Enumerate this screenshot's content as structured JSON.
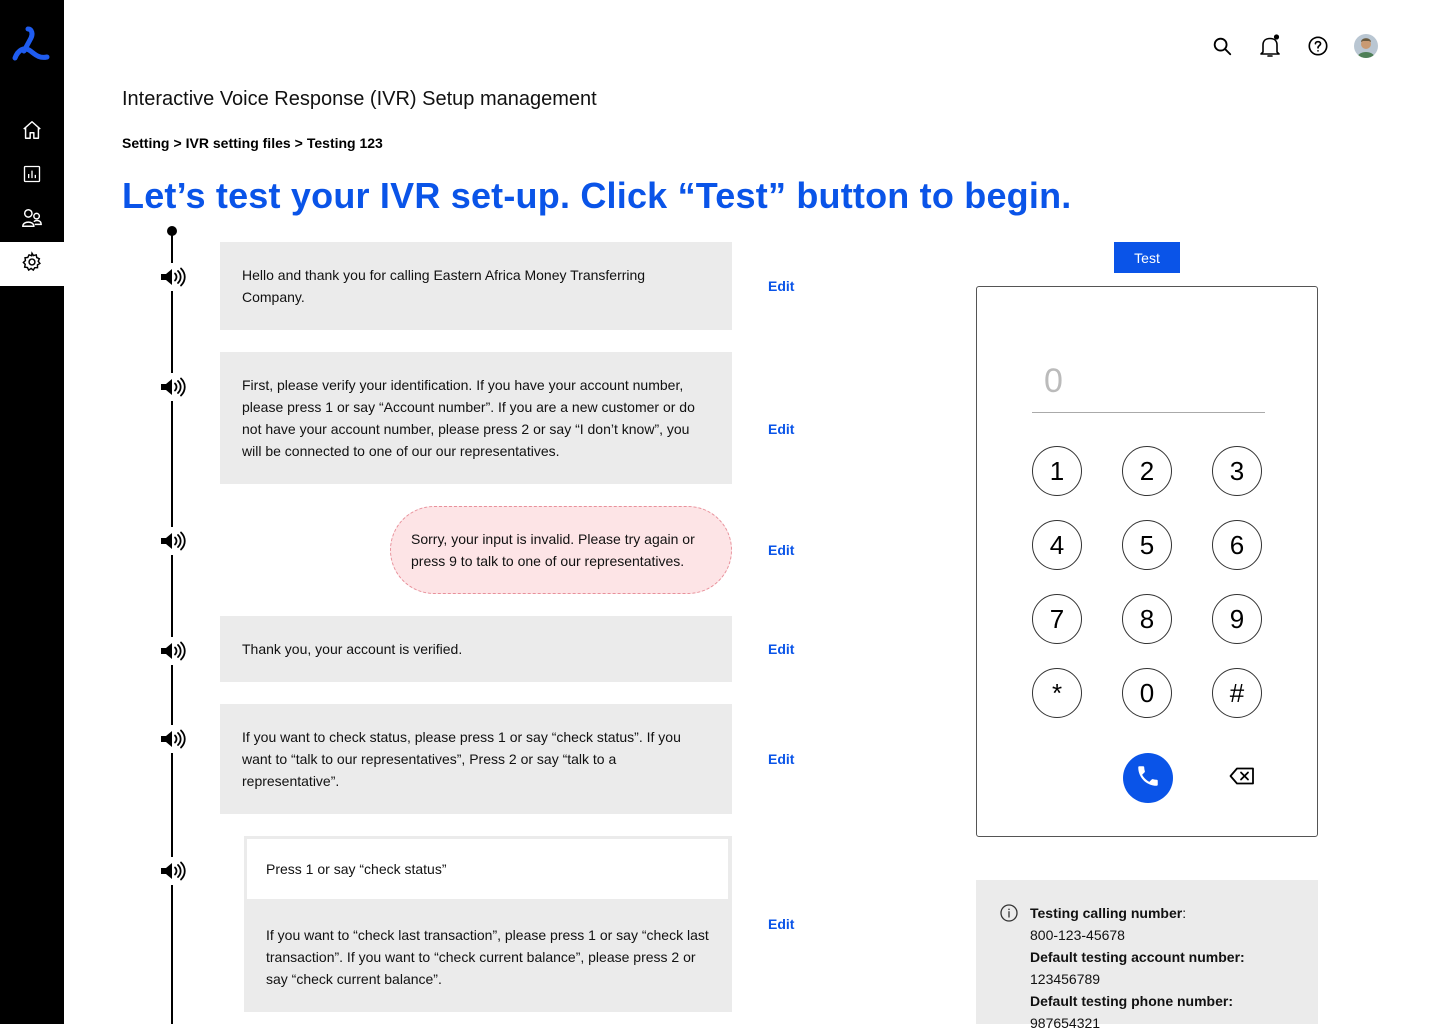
{
  "page": {
    "title": "Interactive Voice Response (IVR) Setup management",
    "headline": "Let’s test your IVR set-up. Click “Test” button to begin."
  },
  "breadcrumb": {
    "items": [
      "Setting",
      "IVR setting files",
      "Testing 123"
    ],
    "separator": ">"
  },
  "messages": [
    "Hello and thank you for calling Eastern Africa Money Transferring Company.",
    "First, please verify your identification. If you have your account number, please press 1 or say “Account number”. If you are a new customer or do not have your account number, please press 2 or say “I don’t know”, you will be connected to one of our our representatives.",
    "Sorry, your input is invalid. Please try again or press 9 to talk to one of our representatives.",
    "Thank you, your account is verified.",
    "If you want to check status, please press 1 or say “check status”. If you want to “talk to our representatives”, Press 2 or say “talk to a representative”.",
    "Press 1 or say “check status”",
    "If you want to “check last transaction”, please press 1 or say “check last transaction”. If you want to “check current balance”, please press 2 or say “check current balance”."
  ],
  "edit_label": "Edit",
  "test_button": "Test",
  "dialer": {
    "placeholder": "0",
    "keys": [
      "1",
      "2",
      "3",
      "4",
      "5",
      "6",
      "7",
      "8",
      "9",
      "*",
      "0",
      "#"
    ]
  },
  "info": {
    "calling_label": "Testing calling number",
    "calling_suffix": ":",
    "calling_value": "800-123-45678",
    "account_label": "Default testing account number:",
    "account_value": "123456789",
    "phone_label": "Default testing phone number:",
    "phone_value": "987654321"
  },
  "colors": {
    "accent": "#0a54e8",
    "error_bg": "#fde4e6",
    "error_border": "#e8919b",
    "card_bg": "#ebebeb",
    "sidebar": "#000000"
  },
  "icons": {
    "sidebar": [
      "logo-icon",
      "home-icon",
      "chart-icon",
      "users-icon",
      "gear-icon"
    ],
    "topbar": [
      "search-icon",
      "bell-icon",
      "help-icon",
      "avatar"
    ],
    "timeline": "speaker-icon"
  }
}
